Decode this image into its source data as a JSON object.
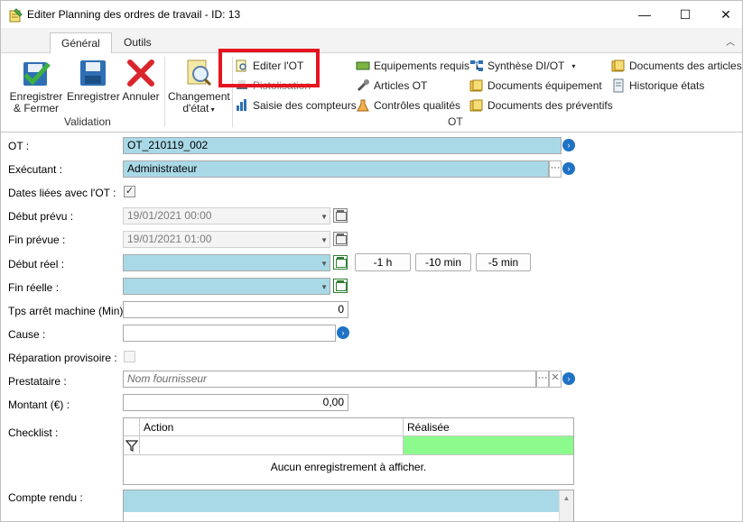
{
  "window": {
    "title": "Editer Planning des ordres de travail - ID: 13",
    "controls": {
      "minimize": "—",
      "maximize": "☐",
      "close": "✕"
    }
  },
  "ribbon": {
    "tabs": [
      {
        "label": "Général",
        "active": true
      },
      {
        "label": "Outils",
        "active": false
      }
    ],
    "validation": {
      "save_close_label": "Enregistrer\n& Fermer",
      "save_label": "Enregistrer",
      "cancel_label": "Annuler",
      "group_label": "Validation"
    },
    "change_state_label": "Changement\nd'état",
    "ot_group": {
      "group_label": "OT",
      "edit_ot": "Editer l'OT",
      "hidden_item": "Pistolisation",
      "meter_entry": "Saisie des compteurs",
      "required_equipment": "Equipements requis",
      "ot_articles": "Articles OT",
      "quality_checks": "Contrôles qualités",
      "di_ot_summary": "Synthèse DI/OT",
      "equipment_documents": "Documents équipement",
      "preventive_documents": "Documents des préventifs",
      "article_documents": "Documents des articles",
      "state_history": "Historique états"
    },
    "highlight_color": "#e6141e"
  },
  "form": {
    "ot": {
      "label": "OT :",
      "value": "OT_210119_002"
    },
    "executant": {
      "label": "Exécutant :",
      "value": "Administrateur"
    },
    "linked_dates": {
      "label": "Dates liées avec l'OT :",
      "checked": true
    },
    "planned_start": {
      "label": "Début prévu :",
      "value": "19/01/2021 00:00"
    },
    "planned_end": {
      "label": "Fin prévue :",
      "value": "19/01/2021 01:00"
    },
    "actual_start": {
      "label": "Début réel :",
      "value": "/     /              :"
    },
    "actual_end": {
      "label": "Fin réelle :",
      "value": "/     /              :"
    },
    "time_buttons": {
      "minus_1h": "-1 h",
      "minus_10min": "-10 min",
      "minus_5min": "-5 min"
    },
    "machine_downtime": {
      "label": "Tps arrêt machine (Min) :",
      "value": "0"
    },
    "cause": {
      "label": "Cause :",
      "value": ""
    },
    "temporary_repair": {
      "label": "Réparation provisoire :",
      "checked": false
    },
    "provider": {
      "label": "Prestataire :",
      "placeholder": "Nom fournisseur"
    },
    "amount": {
      "label": "Montant (€) :",
      "value": "0,00"
    },
    "checklist": {
      "label": "Checklist :",
      "columns": [
        "Action",
        "Réalisée"
      ],
      "empty_text": "Aucun enregistrement à afficher."
    },
    "report": {
      "label": "Compte rendu :"
    }
  },
  "colors": {
    "field_blue": "#a9d9e6",
    "filter_green": "#8dfa8d",
    "accent_blue": "#1f72c4"
  }
}
